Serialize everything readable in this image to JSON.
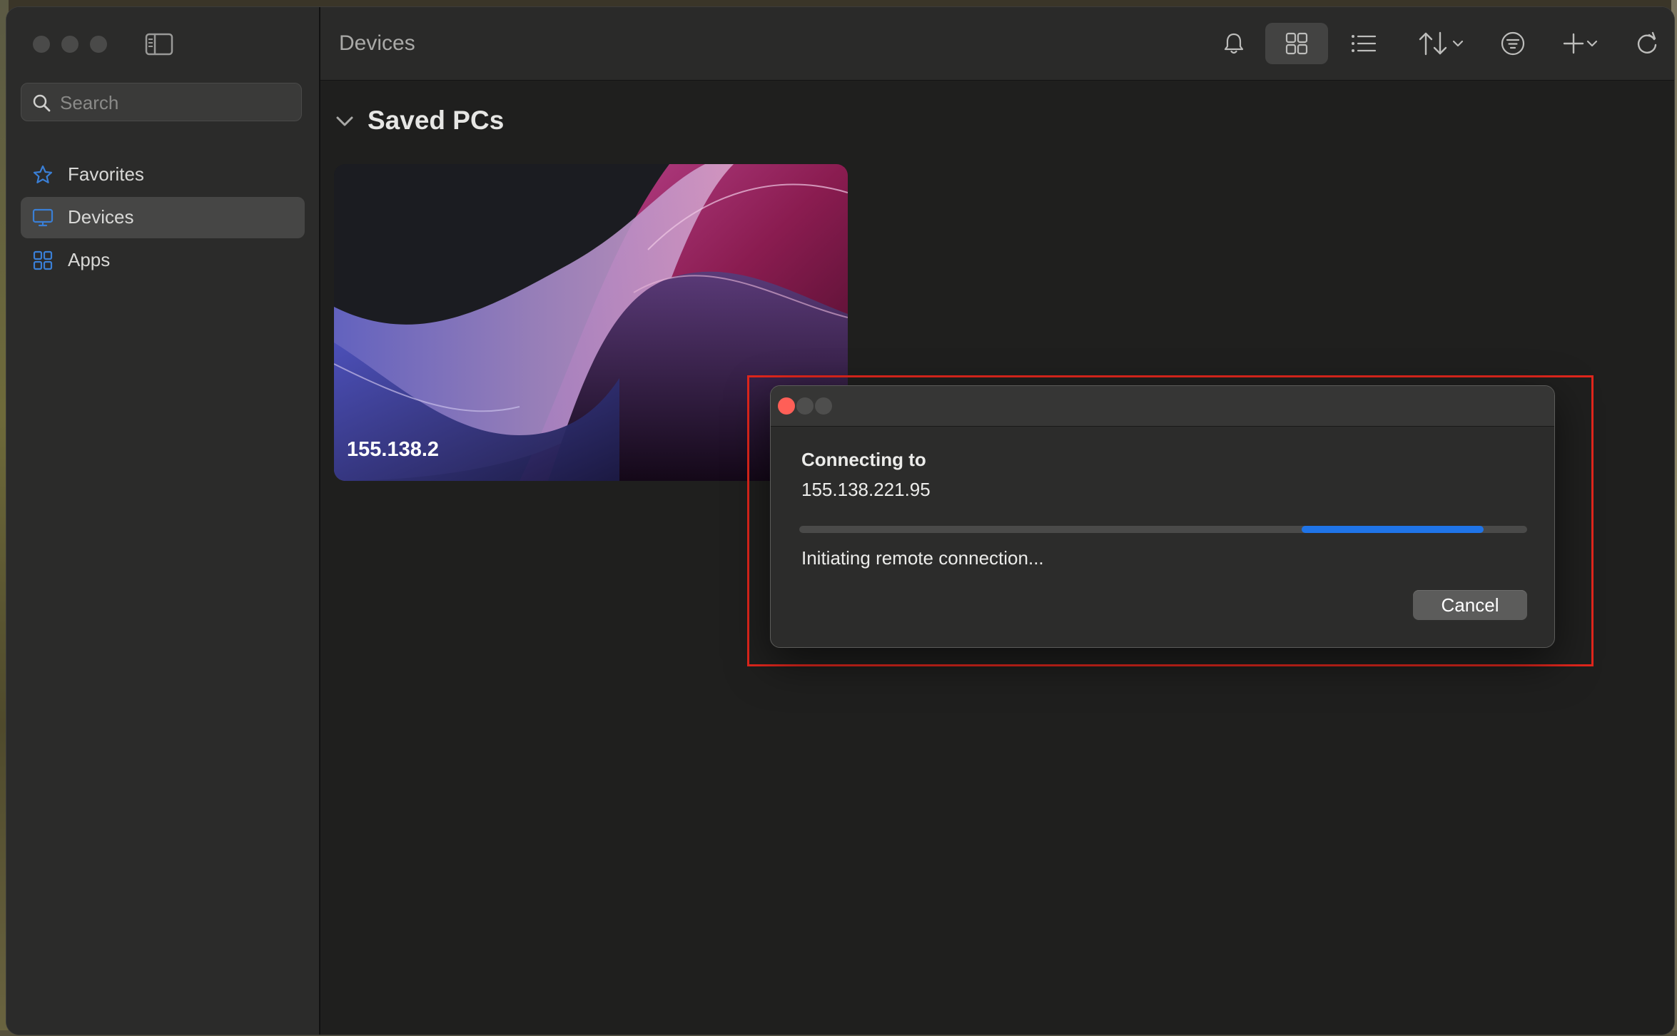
{
  "window": {
    "title": "Devices"
  },
  "sidebar": {
    "search": {
      "placeholder": "Search",
      "value": ""
    },
    "items": [
      {
        "label": "Favorites",
        "icon": "star-icon",
        "active": false
      },
      {
        "label": "Devices",
        "icon": "monitor-icon",
        "active": true
      },
      {
        "label": "Apps",
        "icon": "apps-grid-icon",
        "active": false
      }
    ]
  },
  "toolbar": {
    "icons": [
      "bell-icon",
      "grid-view-icon",
      "list-view-icon",
      "sort-icon",
      "chevron-down-icon",
      "filter-icon",
      "plus-icon",
      "chevron-down-icon",
      "refresh-icon"
    ],
    "active_view": "grid"
  },
  "main": {
    "section_title": "Saved PCs",
    "pcs": [
      {
        "name": "155.138.2"
      }
    ]
  },
  "dialog": {
    "heading": "Connecting to",
    "host": "155.138.221.95",
    "status": "Initiating remote connection...",
    "cancel_label": "Cancel",
    "progress": {
      "indeterminate_segment_start": 0.69,
      "indeterminate_segment_end": 0.94
    }
  },
  "colors": {
    "accent": "#1f74e8",
    "close_light": "#ff5f57",
    "highlight": "#e0261c",
    "sidebar_icon": "#3a7fd6"
  }
}
